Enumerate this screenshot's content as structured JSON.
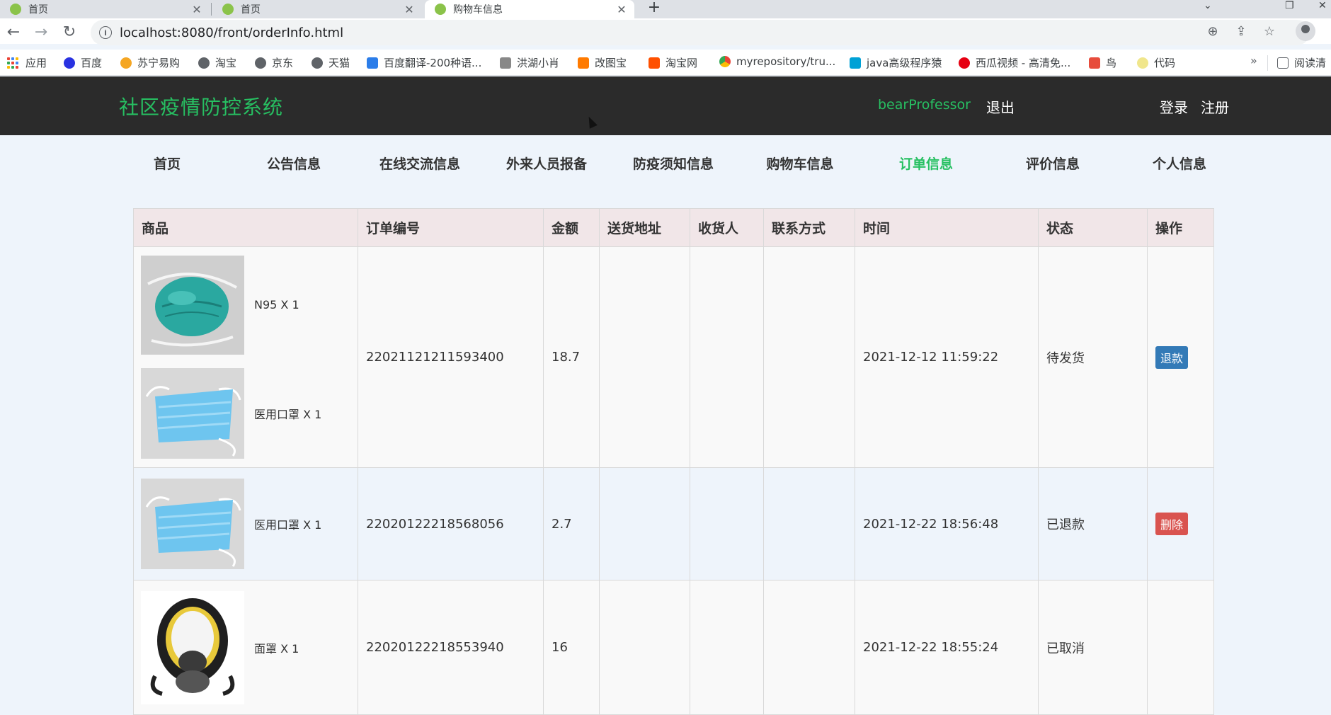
{
  "browser": {
    "tabs": [
      {
        "label": "首页"
      },
      {
        "label": "首页"
      },
      {
        "label": "购物车信息"
      }
    ],
    "url": "localhost:8080/front/orderInfo.html",
    "bookmarks": [
      {
        "label": "应用",
        "icon": "apps-grid-icon",
        "color": "#1a73e8"
      },
      {
        "label": "百度",
        "icon": "baidu-paw-icon",
        "color": "#2932e1"
      },
      {
        "label": "苏宁易购",
        "icon": "suning-lion-icon",
        "color": "#f5a623"
      },
      {
        "label": "淘宝",
        "icon": "globe-icon",
        "color": "#5f6368"
      },
      {
        "label": "京东",
        "icon": "globe-icon",
        "color": "#5f6368"
      },
      {
        "label": "天猫",
        "icon": "globe-icon",
        "color": "#5f6368"
      },
      {
        "label": "百度翻译-200种语...",
        "icon": "translate-icon",
        "color": "#2b7de9"
      },
      {
        "label": "洪湖小肖",
        "icon": "bird-icon",
        "color": "#888888"
      },
      {
        "label": "改图宝",
        "icon": "image-edit-icon",
        "color": "#ff7a00"
      },
      {
        "label": "淘宝网",
        "icon": "taobao-icon",
        "color": "#ff5000"
      },
      {
        "label": "myrepository/tru...",
        "icon": "chrome-icon",
        "color": "#4285f4"
      },
      {
        "label": "java高级程序猿",
        "icon": "bilibili-icon",
        "color": "#00a1d6"
      },
      {
        "label": "西瓜视频 - 高清免...",
        "icon": "play-icon",
        "color": "#e60012"
      },
      {
        "label": "鸟",
        "icon": "bird-red-icon",
        "color": "#e74c3c"
      },
      {
        "label": "代码",
        "icon": "half-moon-icon",
        "color": "#f0e68c"
      }
    ],
    "reading_list": "阅读清"
  },
  "header": {
    "logo": "社区疫情防控系统",
    "username": "bearProfessor",
    "logout": "退出",
    "login": "登录",
    "register": "注册"
  },
  "nav": [
    {
      "label": "首页"
    },
    {
      "label": "公告信息"
    },
    {
      "label": "在线交流信息"
    },
    {
      "label": "外来人员报备"
    },
    {
      "label": "防疫须知信息"
    },
    {
      "label": "购物车信息"
    },
    {
      "label": "订单信息"
    },
    {
      "label": "评价信息"
    },
    {
      "label": "个人信息"
    }
  ],
  "table": {
    "headers": [
      "商品",
      "订单编号",
      "金额",
      "送货地址",
      "收货人",
      "联系方式",
      "时间",
      "状态",
      "操作"
    ],
    "rows": [
      {
        "products": [
          {
            "name": "N95 X 1",
            "image": "n95-mask"
          },
          {
            "name": "医用口罩 X 1",
            "image": "medical-mask"
          }
        ],
        "order_no": "22021121211593400",
        "amount": "18.7",
        "address": "",
        "receiver": "",
        "contact": "",
        "time": "2021-12-12 11:59:22",
        "status": "待发货",
        "action": "退款"
      },
      {
        "products": [
          {
            "name": "医用口罩 X 1",
            "image": "medical-mask"
          }
        ],
        "order_no": "22020122218568056",
        "amount": "2.7",
        "address": "",
        "receiver": "",
        "contact": "",
        "time": "2021-12-22 18:56:48",
        "status": "已退款",
        "action": "删除"
      },
      {
        "products": [
          {
            "name": "面罩 X 1",
            "image": "gas-mask"
          }
        ],
        "order_no": "22020122218553940",
        "amount": "16",
        "address": "",
        "receiver": "",
        "contact": "",
        "time": "2021-12-22 18:55:24",
        "status": "已取消",
        "action": ""
      }
    ]
  },
  "colors": {
    "accent_green": "#27c062",
    "header_bg": "#2b2b2b",
    "refund_btn": "#337ab7",
    "delete_btn": "#d9534f",
    "table_header_bg": "#f1e6e8"
  }
}
